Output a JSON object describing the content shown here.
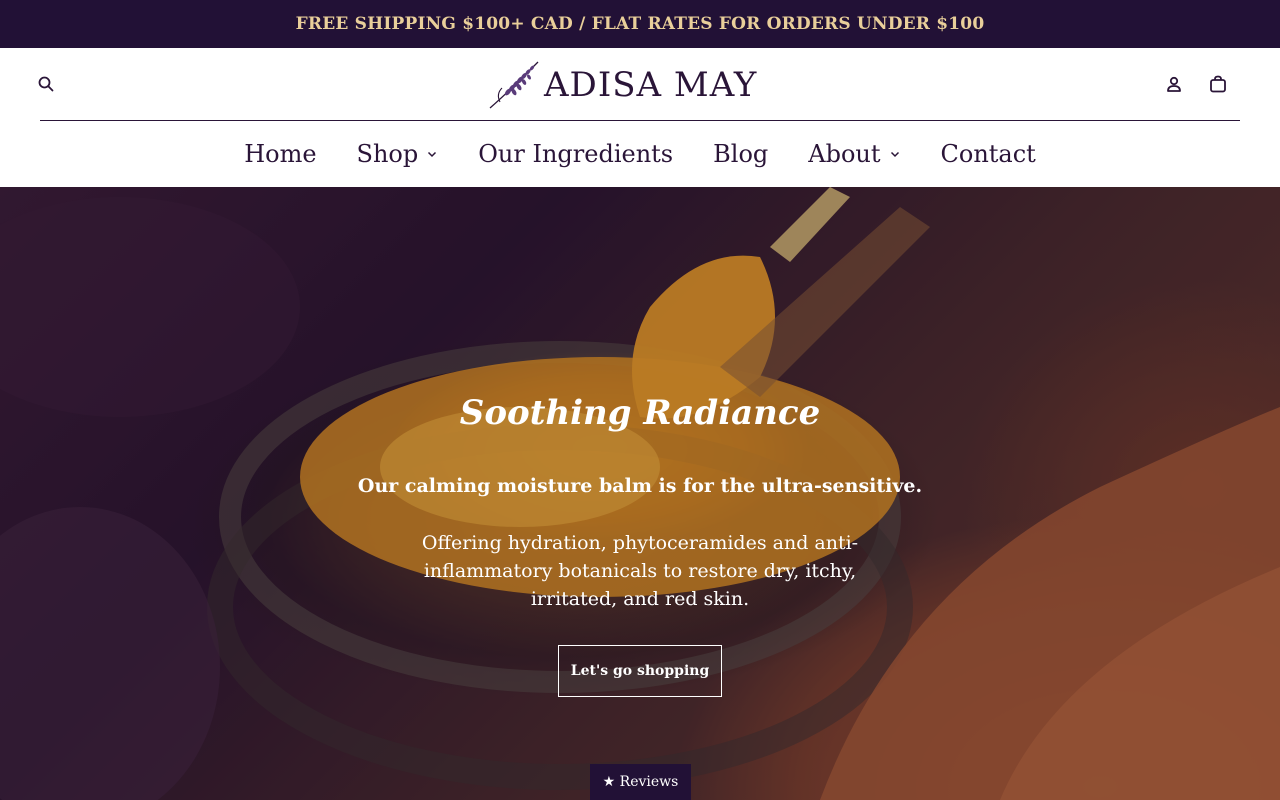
{
  "announcement": {
    "text": "FREE SHIPPING $100+ CAD / FLAT RATES FOR ORDERS UNDER $100"
  },
  "header": {
    "logo_text": "ADISA MAY",
    "nav": [
      {
        "label": "Home"
      },
      {
        "label": "Shop"
      },
      {
        "label": "Our Ingredients"
      },
      {
        "label": "Blog"
      },
      {
        "label": "About"
      },
      {
        "label": "Contact"
      }
    ],
    "icons": [
      "search-icon",
      "account-icon",
      "cart-icon"
    ]
  },
  "hero": {
    "heading": "Soothing Radiance",
    "subtitle": "Our calming moisture balm is for the ultra-sensitive.",
    "body": "Offering hydration, phytoceramides and anti-inflammatory botanicals to restore dry, itchy, irritated, and red skin.",
    "cta_label": "Let's go shopping"
  },
  "reviews_tab": {
    "label": "★ Reviews"
  },
  "colors": {
    "brand_dark": "#221136",
    "announcement_text": "#e9cf9a",
    "text": "#2a1538"
  }
}
